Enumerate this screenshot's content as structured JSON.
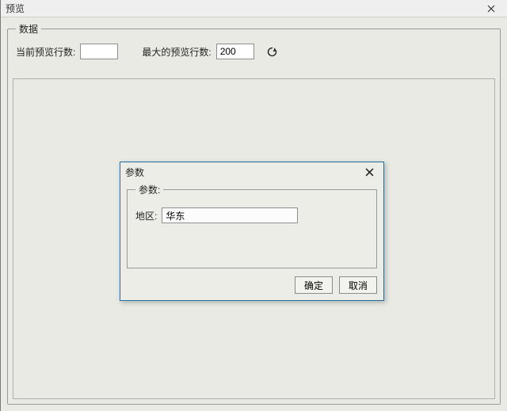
{
  "window": {
    "title": "预览"
  },
  "data_group": {
    "legend": "数据",
    "current_rows_label": "当前预览行数:",
    "current_rows_value": "",
    "max_rows_label": "最大的预览行数:",
    "max_rows_value": "200"
  },
  "modal": {
    "title": "参数",
    "group_legend": "参数:",
    "field_label": "地区:",
    "field_value": "华东",
    "ok_label": "确定",
    "cancel_label": "取消"
  }
}
